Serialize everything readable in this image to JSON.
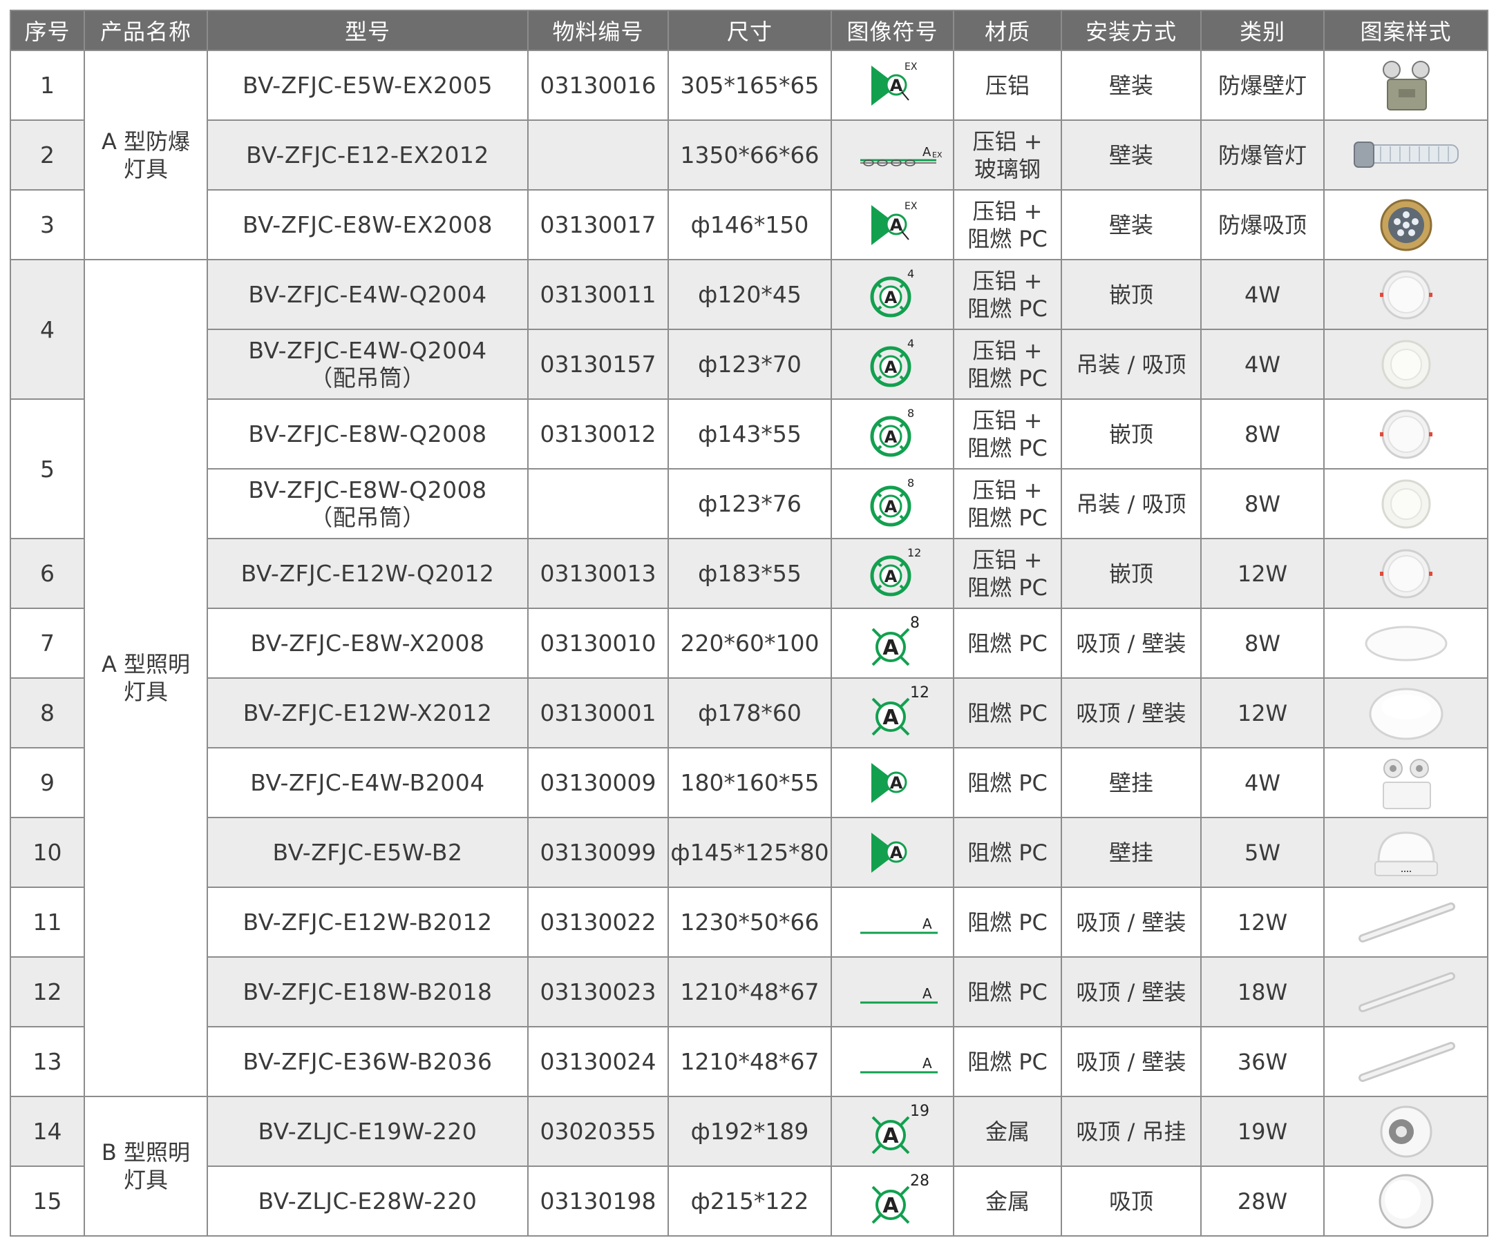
{
  "headers": [
    "序号",
    "产品名称",
    "型号",
    "物料编号",
    "尺寸",
    "图像符号",
    "材质",
    "安装方式",
    "类别",
    "图案样式"
  ],
  "groups": [
    {
      "name": "A 型防爆\n灯具"
    },
    {
      "name": "A 型照明\n灯具"
    },
    {
      "name": "B 型照明\n灯具"
    }
  ],
  "seq_labels": [
    "1",
    "2",
    "3",
    "4",
    "5",
    "6",
    "7",
    "8",
    "9",
    "10",
    "11",
    "12",
    "13",
    "14",
    "15"
  ],
  "rows": [
    {
      "model": "BV-ZFJC-E5W-EX2005",
      "code": "03130016",
      "size": "305*165*65",
      "symbol": {
        "type": "flag",
        "sup": "EX"
      },
      "material": "压铝",
      "install": "壁装",
      "category": "防爆壁灯",
      "image": "twin-head-explosion-proof-light"
    },
    {
      "model": "BV-ZFJC-E12-EX2012",
      "code": "",
      "size": "1350*66*66",
      "symbol": {
        "type": "tube-ex",
        "sup": "A",
        "sub": "EX"
      },
      "material": "压铝 +\n玻璃钢",
      "install": "壁装",
      "category": "防爆管灯",
      "image": "explosion-proof-tube-light"
    },
    {
      "model": "BV-ZFJC-E8W-EX2008",
      "code": "03130017",
      "size": "ф146*150",
      "symbol": {
        "type": "flag",
        "sup": "EX"
      },
      "material": "压铝 +\n阻燃 PC",
      "install": "壁装",
      "category": "防爆吸顶",
      "image": "explosion-proof-ceiling-light"
    },
    {
      "model": "BV-ZFJC-E4W-Q2004",
      "code": "03130011",
      "size": "ф120*45",
      "symbol": {
        "type": "ring",
        "sup": "4"
      },
      "material": "压铝 +\n阻燃 PC",
      "install": "嵌顶",
      "category": "4W",
      "image": "recessed-downlight"
    },
    {
      "model": "BV-ZFJC-E4W-Q2004\n（配吊筒）",
      "code": "03130157",
      "size": "ф123*70",
      "symbol": {
        "type": "ring",
        "sup": "4"
      },
      "material": "压铝 +\n阻燃 PC",
      "install": "吊装 / 吸顶",
      "category": "4W",
      "image": "surface-downlight"
    },
    {
      "model": "BV-ZFJC-E8W-Q2008",
      "code": "03130012",
      "size": "ф143*55",
      "symbol": {
        "type": "ring",
        "sup": "8"
      },
      "material": "压铝 +\n阻燃 PC",
      "install": "嵌顶",
      "category": "8W",
      "image": "recessed-downlight"
    },
    {
      "model": "BV-ZFJC-E8W-Q2008\n（配吊筒）",
      "code": "",
      "size": "ф123*76",
      "symbol": {
        "type": "ring",
        "sup": "8"
      },
      "material": "压铝 +\n阻燃 PC",
      "install": "吊装 / 吸顶",
      "category": "8W",
      "image": "surface-downlight"
    },
    {
      "model": "BV-ZFJC-E12W-Q2012",
      "code": "03130013",
      "size": "ф183*55",
      "symbol": {
        "type": "ring",
        "sup": "12"
      },
      "material": "压铝 +\n阻燃 PC",
      "install": "嵌顶",
      "category": "12W",
      "image": "recessed-downlight"
    },
    {
      "model": "BV-ZFJC-E8W-X2008",
      "code": "03130010",
      "size": "220*60*100",
      "symbol": {
        "type": "cross",
        "sup": "8"
      },
      "material": "阻燃 PC",
      "install": "吸顶 / 壁装",
      "category": "8W",
      "image": "oval-bulkhead-light"
    },
    {
      "model": "BV-ZFJC-E12W-X2012",
      "code": "03130001",
      "size": "ф178*60",
      "symbol": {
        "type": "cross",
        "sup": "12"
      },
      "material": "阻燃 PC",
      "install": "吸顶 / 壁装",
      "category": "12W",
      "image": "round-ceiling-light"
    },
    {
      "model": "BV-ZFJC-E4W-B2004",
      "code": "03130009",
      "size": "180*160*55",
      "symbol": {
        "type": "flag",
        "sup": ""
      },
      "material": "阻燃 PC",
      "install": "壁挂",
      "category": "4W",
      "image": "twin-spot-emergency-light"
    },
    {
      "model": "BV-ZFJC-E5W-B2",
      "code": "03130099",
      "size": "ф145*125*80",
      "symbol": {
        "type": "flag",
        "sup": ""
      },
      "material": "阻燃 PC",
      "install": "壁挂",
      "category": "5W",
      "image": "half-dome-wall-light"
    },
    {
      "model": "BV-ZFJC-E12W-B2012",
      "code": "03130022",
      "size": "1230*50*66",
      "symbol": {
        "type": "line",
        "sup": "A"
      },
      "material": "阻燃 PC",
      "install": "吸顶 / 壁装",
      "category": "12W",
      "image": "batten-tube-light"
    },
    {
      "model": "BV-ZFJC-E18W-B2018",
      "code": "03130023",
      "size": "1210*48*67",
      "symbol": {
        "type": "line",
        "sup": "A"
      },
      "material": "阻燃 PC",
      "install": "吸顶 / 壁装",
      "category": "18W",
      "image": "batten-tube-light"
    },
    {
      "model": "BV-ZFJC-E36W-B2036",
      "code": "03130024",
      "size": "1210*48*67",
      "symbol": {
        "type": "line",
        "sup": "A"
      },
      "material": "阻燃 PC",
      "install": "吸顶 / 壁装",
      "category": "36W",
      "image": "batten-tube-light"
    },
    {
      "model": "BV-ZLJC-E19W-220",
      "code": "03020355",
      "size": "ф192*189",
      "symbol": {
        "type": "cross",
        "sup": "19"
      },
      "material": "金属",
      "install": "吸顶 / 吊挂",
      "category": "19W",
      "image": "surface-spotlight"
    },
    {
      "model": "BV-ZLJC-E28W-220",
      "code": "03130198",
      "size": "ф215*122",
      "symbol": {
        "type": "cross",
        "sup": "28"
      },
      "material": "金属",
      "install": "吸顶",
      "category": "28W",
      "image": "surface-cylinder-light"
    }
  ],
  "colors": {
    "header_bg": "#6e6e6e",
    "header_text": "#ffffff",
    "border": "#8c8c8c",
    "stripe": "#ececec",
    "symbol_green": "#12a04f",
    "text": "#3a3a3a"
  }
}
